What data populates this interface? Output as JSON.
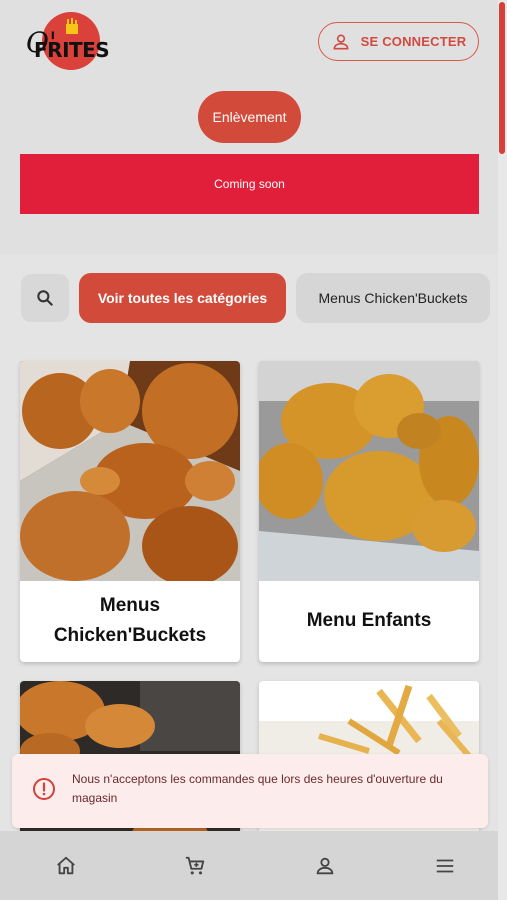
{
  "header": {
    "logo_text": "FRITES",
    "logo_letter": "O'",
    "login_label": "SE CONNECTER"
  },
  "mode_button": "Enlèvement",
  "banner": "Coming soon",
  "categories": {
    "search_icon": "search-icon",
    "active_label": "Voir toutes les catégories",
    "next_label": "Menus Chicken'Buckets"
  },
  "cards": [
    {
      "label_line1": "Menus",
      "label_line2": "Chicken'Buckets"
    },
    {
      "label_line1": "Menu Enfants"
    }
  ],
  "alert": {
    "text": "Nous n'acceptons les commandes que lors des heures d'ouverture du magasin"
  },
  "bottom_nav": [
    "home-icon",
    "cart-icon",
    "user-icon",
    "menu-icon"
  ],
  "colors": {
    "accent": "#d24a3a",
    "banner": "#e21f3a",
    "alert_bg": "#fdecec"
  }
}
